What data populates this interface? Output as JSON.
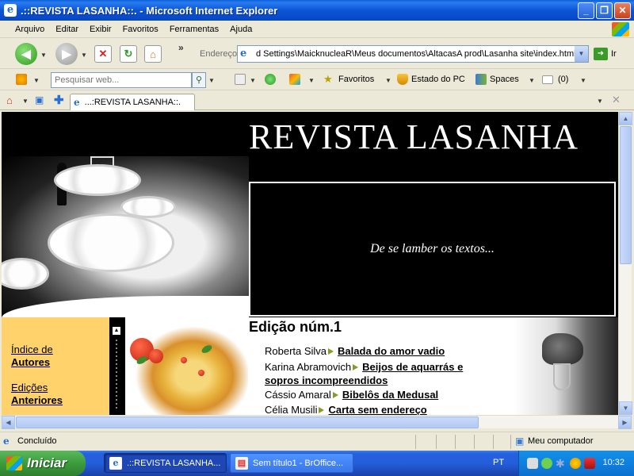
{
  "window": {
    "title": ".::REVISTA LASANHA::. - Microsoft Internet Explorer",
    "buttons": {
      "minimize": "_",
      "maximize": "❐",
      "close": "✕"
    }
  },
  "menubar": [
    "Arquivo",
    "Editar",
    "Exibir",
    "Favoritos",
    "Ferramentas",
    "Ajuda"
  ],
  "toolbar": {
    "address_label": "Endereço",
    "address_value": "d Settings\\MaicknucleaR\\Meus documentos\\AltacasA prod\\Lasanha site\\index.html",
    "go_label": "Ir"
  },
  "linksbar": {
    "search_placeholder": "Pesquisar web...",
    "favoritos": "Favoritos",
    "estado_pc": "Estado do PC",
    "spaces": "Spaces",
    "mail_count": "(0)"
  },
  "tab": {
    "label": "...:REVISTA LASANHA::."
  },
  "page": {
    "site_title": "REVISTA LASANHA",
    "tagline": "De se lamber os textos...",
    "nav": [
      {
        "line1": "Índice de",
        "line2": "Autores"
      },
      {
        "line1": "Edições",
        "line2": "Anteriores"
      }
    ],
    "edition_title": "Edição núm.1",
    "articles": [
      {
        "author": "Roberta Silva",
        "title": "Balada do amor vadio",
        "title2": ""
      },
      {
        "author": "Karina Abramovich",
        "title": "Beijos de aquarrás e",
        "title2": "sopros incompreendidos"
      },
      {
        "author": "Cássio Amaral",
        "title": "Bibelôs da Medusal",
        "title2": ""
      },
      {
        "author": "Célia Musili",
        "title": "Carta sem endereço",
        "title2": ""
      }
    ]
  },
  "statusbar": {
    "status": "Concluído",
    "zone": "Meu computador"
  },
  "taskbar": {
    "start": "Iniciar",
    "tasks": [
      ".::REVISTA LASANHA...",
      "Sem título1 - BrOffice..."
    ],
    "lang": "PT",
    "clock": "10:32"
  },
  "colors": {
    "nav_bg": "#ffd26b",
    "title_bar": "#0b55d6",
    "taskbar": "#245edb"
  }
}
